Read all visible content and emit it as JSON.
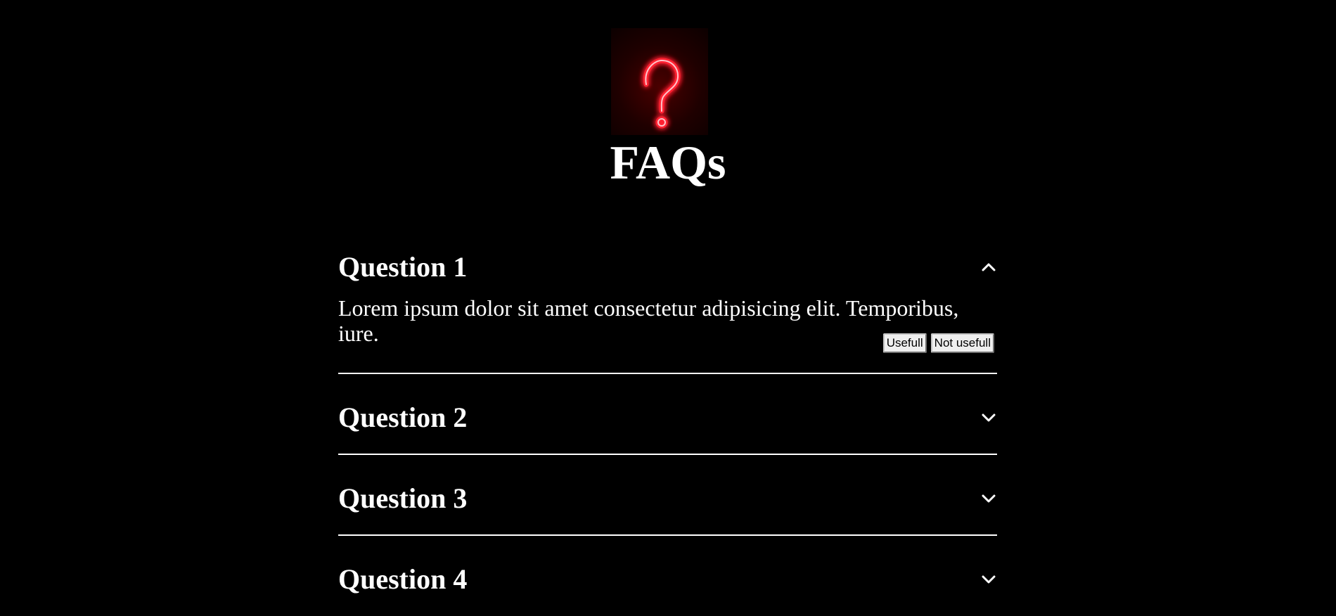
{
  "page": {
    "title": "FAQs",
    "hero_icon": "neon-question-mark-icon",
    "colors": {
      "background": "#000000",
      "text": "#ffffff",
      "neon": "#ff1a2a",
      "divider": "#ffffff"
    }
  },
  "faqs": [
    {
      "question": "Question 1",
      "expanded": true,
      "answer": "Lorem ipsum dolor sit amet consectetur adipisicing elit. Temporibus, iure.",
      "useful_label": "Usefull",
      "not_useful_label": "Not usefull",
      "icon": "chevron-up-icon"
    },
    {
      "question": "Question 2",
      "expanded": false,
      "icon": "chevron-down-icon"
    },
    {
      "question": "Question 3",
      "expanded": false,
      "icon": "chevron-down-icon"
    },
    {
      "question": "Question 4",
      "expanded": false,
      "icon": "chevron-down-icon"
    }
  ]
}
